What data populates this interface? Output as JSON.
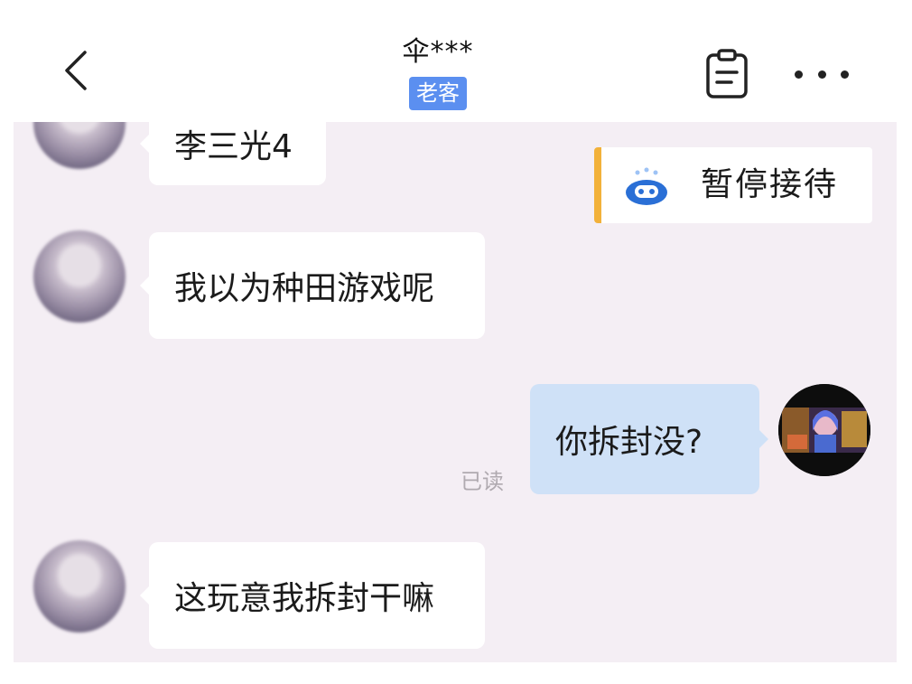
{
  "header": {
    "title": "伞***",
    "tag": "老客",
    "back_icon": "chevron-left-icon",
    "clipboard_icon": "clipboard-icon",
    "more_icon": "more-horizontal-icon"
  },
  "status_card": {
    "label": "暂停接待",
    "icon": "robot-icon",
    "accent_color": "#f2b13a"
  },
  "messages": [
    {
      "from": "customer",
      "text": "李三光4"
    },
    {
      "from": "customer",
      "text": "我以为种田游戏呢"
    },
    {
      "from": "agent",
      "text": "你拆封没?",
      "status": "已读"
    },
    {
      "from": "customer",
      "text": "这玩意我拆封干嘛"
    }
  ],
  "colors": {
    "chat_background": "#f4eef4",
    "agent_bubble": "#cfe1f7",
    "tag_background": "#5b8ff0"
  }
}
